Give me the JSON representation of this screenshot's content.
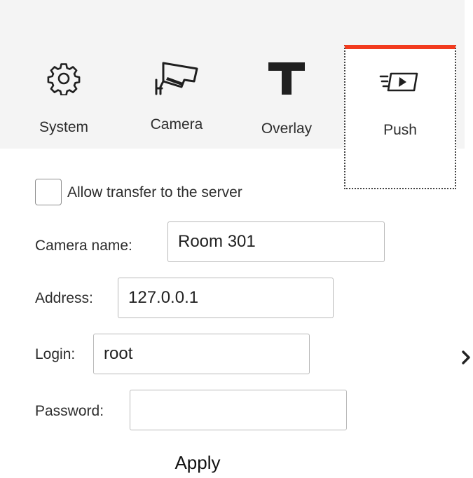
{
  "tabs": [
    {
      "id": "system",
      "label": "System",
      "icon": "gear-icon"
    },
    {
      "id": "camera",
      "label": "Camera",
      "icon": "security-camera-icon"
    },
    {
      "id": "overlay",
      "label": "Overlay",
      "icon": "text-t-icon"
    },
    {
      "id": "push",
      "label": "Push",
      "icon": "push-video-icon",
      "active": true
    }
  ],
  "accent_color": "#f23b1e",
  "form": {
    "allow_transfer_label": "Allow transfer to the server",
    "allow_transfer_checked": false,
    "camera_name_label": "Camera name:",
    "camera_name_value": "Room 301",
    "address_label": "Address:",
    "address_value": "127.0.0.1",
    "login_label": "Login:",
    "login_value": "root",
    "password_label": "Password:",
    "password_value": "",
    "apply_label": "Apply"
  },
  "nav": {
    "next_icon": "chevron-right-icon"
  }
}
